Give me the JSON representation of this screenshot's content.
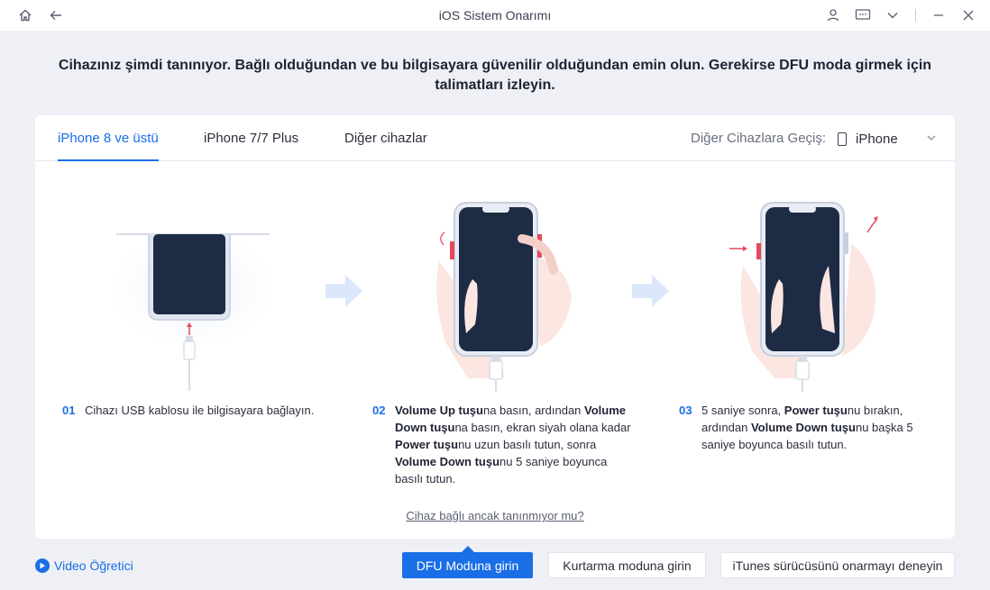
{
  "window": {
    "title": "iOS Sistem Onarımı"
  },
  "heading": "Cihazınız şimdi tanınıyor. Bağlı olduğundan ve bu bilgisayara güvenilir olduğundan emin olun. Gerekirse DFU moda girmek için talimatları izleyin.",
  "tabs": [
    {
      "label": "iPhone 8 ve üstü",
      "active": true
    },
    {
      "label": "iPhone 7/7 Plus",
      "active": false
    },
    {
      "label": "Diğer cihazlar",
      "active": false
    }
  ],
  "device_switch": {
    "label": "Diğer Cihazlara Geçiş:",
    "selected": "iPhone"
  },
  "steps": [
    {
      "num": "01",
      "parts": [
        {
          "t": "Cihazı USB kablosu ile bilgisayara bağlayın.",
          "b": false
        }
      ]
    },
    {
      "num": "02",
      "parts": [
        {
          "t": "Volume Up tuşu",
          "b": true
        },
        {
          "t": "na basın, ardından ",
          "b": false
        },
        {
          "t": "Volume Down tuşu",
          "b": true
        },
        {
          "t": "na basın, ekran siyah olana kadar ",
          "b": false
        },
        {
          "t": "Power tuşu",
          "b": true
        },
        {
          "t": "nu uzun basılı tutun, sonra ",
          "b": false
        },
        {
          "t": "Volume Down tuşu",
          "b": true
        },
        {
          "t": "nu 5 saniye boyunca basılı tutun.",
          "b": false
        }
      ]
    },
    {
      "num": "03",
      "parts": [
        {
          "t": "5 saniye sonra, ",
          "b": false
        },
        {
          "t": "Power tuşu",
          "b": true
        },
        {
          "t": "nu bırakın, ardından ",
          "b": false
        },
        {
          "t": "Volume Down tuşu",
          "b": true
        },
        {
          "t": "nu başka 5 saniye boyunca basılı tutun.",
          "b": false
        }
      ]
    }
  ],
  "help_link": "Cihaz bağlı ancak tanınmıyor mu?",
  "footer": {
    "video_label": "Video Öğretici",
    "btn_dfu": "DFU Moduna girin",
    "btn_recovery": "Kurtarma moduna girin",
    "btn_itunes": "iTunes sürücüsünü onarmayı deneyin"
  },
  "colors": {
    "accent": "#1a6ee6",
    "phone_screen": "#1e2b45",
    "button_red": "#e8485a"
  },
  "icons": [
    "home-icon",
    "back-arrow-icon",
    "user-icon",
    "feedback-icon",
    "chevron-down-icon",
    "minimize-icon",
    "close-icon",
    "phone-icon",
    "play-icon"
  ]
}
